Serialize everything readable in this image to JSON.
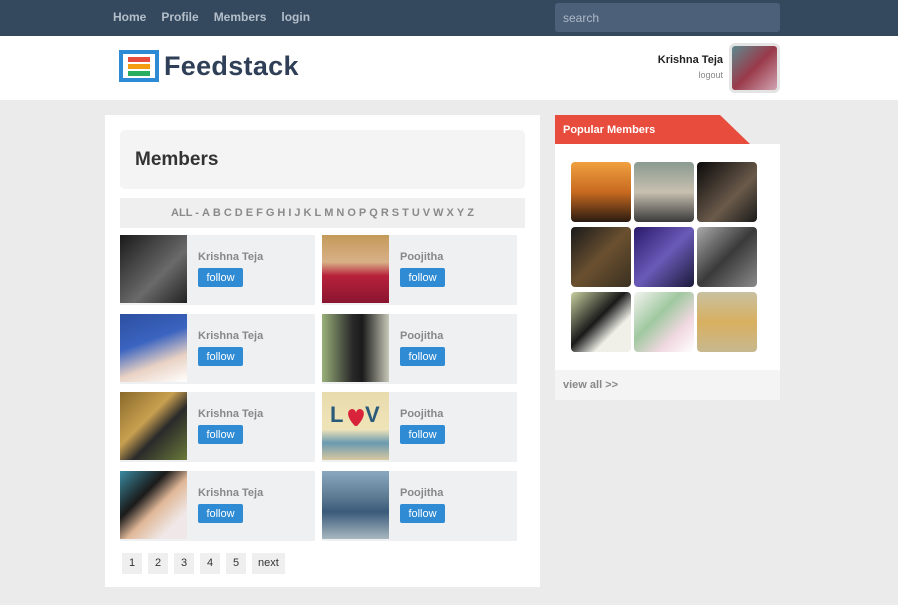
{
  "nav": {
    "items": [
      {
        "label": "Home"
      },
      {
        "label": "Profile"
      },
      {
        "label": "Members"
      },
      {
        "label": "login"
      }
    ],
    "search_placeholder": "search"
  },
  "header": {
    "logo_text": "Feedstack",
    "user_name": "Krishna Teja",
    "logout_label": "logout"
  },
  "main": {
    "title": "Members",
    "alphabet": [
      "ALL -",
      "A",
      "B",
      "C",
      "D",
      "E",
      "F",
      "G",
      "H",
      "I",
      "J",
      "K",
      "L",
      "M",
      "N",
      "O",
      "P",
      "Q",
      "R",
      "S",
      "T",
      "U",
      "V",
      "W",
      "X",
      "Y",
      "Z"
    ],
    "members": [
      {
        "name": "Krishna Teja",
        "follow_label": "follow"
      },
      {
        "name": "Poojitha",
        "follow_label": "follow"
      },
      {
        "name": "Krishna Teja",
        "follow_label": "follow"
      },
      {
        "name": "Poojitha",
        "follow_label": "follow"
      },
      {
        "name": "Krishna Teja",
        "follow_label": "follow"
      },
      {
        "name": "Poojitha",
        "follow_label": "follow"
      },
      {
        "name": "Krishna Teja",
        "follow_label": "follow"
      },
      {
        "name": "Poojitha",
        "follow_label": "follow"
      }
    ],
    "pagination": [
      "1",
      "2",
      "3",
      "4",
      "5",
      "next"
    ]
  },
  "sidebar": {
    "title": "Popular Members",
    "view_all_label": "view all >>"
  },
  "colors": {
    "topbar": "#34495e",
    "accent_blue": "#2f8bd4",
    "accent_red": "#e74c3c"
  }
}
